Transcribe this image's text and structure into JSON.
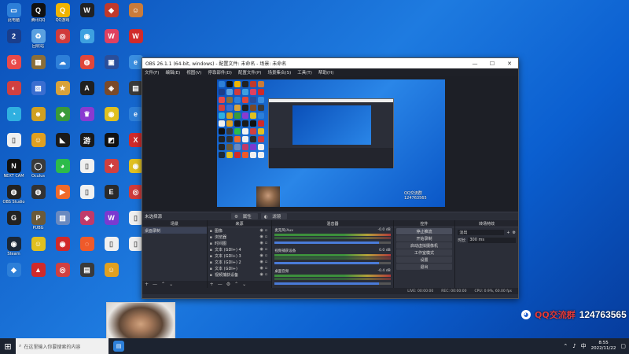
{
  "desktop": {
    "icons": [
      {
        "label": "此电脑",
        "icon": "computer-icon",
        "color": "#2d7fd8",
        "glyph": "▭"
      },
      {
        "label": "腾讯QQ",
        "icon": "qq-icon",
        "color": "#111111",
        "glyph": "Q"
      },
      {
        "label": "QQ游戏",
        "icon": "qqgame-icon",
        "color": "#f0b400",
        "glyph": "Q"
      },
      {
        "label": "",
        "icon": "app-icon",
        "color": "#222222",
        "glyph": "W"
      },
      {
        "label": "",
        "icon": "app-icon",
        "color": "#c0392b",
        "glyph": "◆"
      },
      {
        "label": "",
        "icon": "app-icon",
        "color": "#c97b3a",
        "glyph": "☺"
      },
      {
        "label": "",
        "icon": "app-icon",
        "color": "#1a3e8c",
        "glyph": "2"
      },
      {
        "label": "回收站",
        "icon": "recycle-bin-icon",
        "color": "#5aa0e0",
        "glyph": "♻"
      },
      {
        "label": "",
        "icon": "app-icon",
        "color": "#d03b3b",
        "glyph": "◎"
      },
      {
        "label": "",
        "icon": "app-icon",
        "color": "#3da0e0",
        "glyph": "◉"
      },
      {
        "label": "",
        "icon": "app-icon",
        "color": "#e04060",
        "glyph": "W"
      },
      {
        "label": "",
        "icon": "app-icon",
        "color": "#d02a2a",
        "glyph": "W"
      },
      {
        "label": "",
        "icon": "app-icon",
        "color": "#e84a4a",
        "glyph": "G"
      },
      {
        "label": "",
        "icon": "app-icon",
        "color": "#8a6e3a",
        "glyph": "▦"
      },
      {
        "label": "",
        "icon": "app-icon",
        "color": "#2d7fd8",
        "glyph": "☁"
      },
      {
        "label": "",
        "icon": "app-icon",
        "color": "#e0463a",
        "glyph": "◍"
      },
      {
        "label": "",
        "icon": "app-icon",
        "color": "#2a4e9a",
        "glyph": "▣"
      },
      {
        "label": "",
        "icon": "app-icon",
        "color": "#3a8ee0",
        "glyph": "e"
      },
      {
        "label": "",
        "icon": "app-icon",
        "color": "#d04040",
        "glyph": "◐"
      },
      {
        "label": "",
        "icon": "app-icon",
        "color": "#3a6ed0",
        "glyph": "▧"
      },
      {
        "label": "",
        "icon": "app-icon",
        "color": "#d9a23a",
        "glyph": "★"
      },
      {
        "label": "",
        "icon": "app-icon",
        "color": "#202020",
        "glyph": "A"
      },
      {
        "label": "",
        "icon": "app-icon",
        "color": "#7a4a2a",
        "glyph": "◈"
      },
      {
        "label": "",
        "icon": "app-icon",
        "color": "#3a3a3a",
        "glyph": "▤"
      },
      {
        "label": "",
        "icon": "app-icon",
        "color": "#2fb0e0",
        "glyph": "◔"
      },
      {
        "label": "",
        "icon": "app-icon",
        "color": "#d0a020",
        "glyph": "☻"
      },
      {
        "label": "",
        "icon": "app-icon",
        "color": "#3a9a3a",
        "glyph": "◆"
      },
      {
        "label": "",
        "icon": "app-icon",
        "color": "#8a3ad0",
        "glyph": "♛"
      },
      {
        "label": "",
        "icon": "app-icon",
        "color": "#e0c020",
        "glyph": "◉"
      },
      {
        "label": "",
        "icon": "app-icon",
        "color": "#2d7fd8",
        "glyph": "e"
      },
      {
        "label": "",
        "icon": "app-icon",
        "color": "#f0f0f0",
        "glyph": "▯"
      },
      {
        "label": "",
        "icon": "app-icon",
        "color": "#e0a020",
        "glyph": "☺"
      },
      {
        "label": "",
        "icon": "app-icon",
        "color": "#1a1a1a",
        "glyph": "◣"
      },
      {
        "label": "",
        "icon": "app-icon",
        "color": "#1a1a1a",
        "glyph": "游"
      },
      {
        "label": "",
        "icon": "app-icon",
        "color": "#111111",
        "glyph": "◩"
      },
      {
        "label": "",
        "icon": "app-icon",
        "color": "#d02a2a",
        "glyph": "X"
      },
      {
        "label": "NEXT CAM",
        "icon": "nextcam-icon",
        "color": "#111111",
        "glyph": "N"
      },
      {
        "label": "Oculus",
        "icon": "app-icon",
        "color": "#3a3a3a",
        "glyph": "◯"
      },
      {
        "label": "",
        "icon": "wechat-icon",
        "color": "#2dbb4a",
        "glyph": "◕"
      },
      {
        "label": "",
        "icon": "app-icon",
        "color": "#f0f0f0",
        "glyph": "▯"
      },
      {
        "label": "",
        "icon": "app-icon",
        "color": "#d04040",
        "glyph": "✦"
      },
      {
        "label": "",
        "icon": "app-icon",
        "color": "#e0c020",
        "glyph": "◉"
      },
      {
        "label": "OBS Studio",
        "icon": "obs-icon",
        "color": "#222222",
        "glyph": "◍"
      },
      {
        "label": "",
        "icon": "obs-icon",
        "color": "#333333",
        "glyph": "◍"
      },
      {
        "label": "",
        "icon": "app-icon",
        "color": "#ef6a2a",
        "glyph": "▶"
      },
      {
        "label": "",
        "icon": "app-icon",
        "color": "#f0f0f0",
        "glyph": "▯"
      },
      {
        "label": "",
        "icon": "epic-icon",
        "color": "#2a2a2a",
        "glyph": "E"
      },
      {
        "label": "",
        "icon": "app-icon",
        "color": "#d03b3b",
        "glyph": "◎"
      },
      {
        "label": "",
        "icon": "app-icon",
        "color": "#222222",
        "glyph": "G"
      },
      {
        "label": "PUBG",
        "icon": "pubg-icon",
        "color": "#6a5a3a",
        "glyph": "P"
      },
      {
        "label": "",
        "icon": "app-icon",
        "color": "#6a8ac0",
        "glyph": "▥"
      },
      {
        "label": "",
        "icon": "app-icon",
        "color": "#c03a6a",
        "glyph": "◈"
      },
      {
        "label": "",
        "icon": "app-icon",
        "color": "#7a3ad0",
        "glyph": "W"
      },
      {
        "label": "",
        "icon": "app-icon",
        "color": "#f0f0f0",
        "glyph": "▯"
      },
      {
        "label": "Steam",
        "icon": "steam-icon",
        "color": "#1b2838",
        "glyph": "◉"
      },
      {
        "label": "",
        "icon": "app-icon",
        "color": "#e0c020",
        "glyph": "☺"
      },
      {
        "label": "",
        "icon": "app-icon",
        "color": "#d02a2a",
        "glyph": "◉"
      },
      {
        "label": "",
        "icon": "app-icon",
        "color": "#ef5a2a",
        "glyph": "◌"
      },
      {
        "label": "",
        "icon": "app-icon",
        "color": "#f0f0f0",
        "glyph": "▯"
      },
      {
        "label": "",
        "icon": "app-icon",
        "color": "#f0f0f0",
        "glyph": "▯"
      },
      {
        "label": "",
        "icon": "app-icon",
        "color": "#2d7fd8",
        "glyph": "◆"
      },
      {
        "label": "",
        "icon": "app-icon",
        "color": "#d02a2a",
        "glyph": "▲"
      },
      {
        "label": "",
        "icon": "app-icon",
        "color": "#d04040",
        "glyph": "◎"
      },
      {
        "label": "",
        "icon": "app-icon",
        "color": "#3a3a3a",
        "glyph": "▤"
      },
      {
        "label": "",
        "icon": "app-icon",
        "color": "#e0a020",
        "glyph": "☺"
      }
    ]
  },
  "obs": {
    "title": "OBS 26.1.1 (64-bit, windows) - 配置文件: 未命名 - 场景: 未命名",
    "menu": [
      "文件(F)",
      "编辑(E)",
      "视图(V)",
      "停靠部件(D)",
      "配置文件(P)",
      "场景集合(S)",
      "工具(T)",
      "帮助(H)"
    ],
    "scene_bar_label": "未选择源",
    "props_button": "属性",
    "filters_button": "滤镜",
    "watermark": "QQ交流群 124763565",
    "scenes": {
      "title": "场景",
      "items": [
        "桌面录制"
      ]
    },
    "sources": {
      "title": "来源",
      "items": [
        {
          "icon": "image-icon",
          "name": "图像"
        },
        {
          "icon": "browser-icon",
          "name": "浏览器"
        },
        {
          "icon": "clock-icon",
          "name": "时间图"
        },
        {
          "icon": "text-icon",
          "name": "文本 (GDI+) 4"
        },
        {
          "icon": "text-icon",
          "name": "文本 (GDI+) 3"
        },
        {
          "icon": "text-icon",
          "name": "文本 (GDI+) 2"
        },
        {
          "icon": "text-icon",
          "name": "文本 (GDI+)"
        },
        {
          "icon": "camera-icon",
          "name": "视频捕获设备"
        }
      ]
    },
    "mixer": {
      "title": "混音器",
      "channels": [
        {
          "name": "麦克风/Aux",
          "db": "-0.0 dB",
          "level": 0.9
        },
        {
          "name": "视频捕获设备",
          "db": "0.0 dB",
          "level": 0.9
        },
        {
          "name": "桌面音频",
          "db": "-0.4 dB",
          "level": 0.9
        }
      ]
    },
    "transitions": {
      "title": "转场特效",
      "selected": "淡出",
      "duration_label": "时长",
      "duration_value": "300 ms"
    },
    "controls": {
      "title": "控件",
      "buttons": [
        "停止推流",
        "开始录制",
        "启动虚拟摄像机",
        "工作室模式",
        "设置",
        "退出"
      ]
    },
    "status": {
      "live": "LIVE: 00:00:00",
      "rec": "REC: 00:00:00",
      "cpu": "CPU: 0.9%, 60.00 fps"
    }
  },
  "overlay": {
    "qq_label": "QQ交流群",
    "qq_number": "124763565"
  },
  "taskbar": {
    "search_placeholder": "在这里输入你要搜索的内容",
    "time": "8:55",
    "date": "2022/11/22"
  }
}
